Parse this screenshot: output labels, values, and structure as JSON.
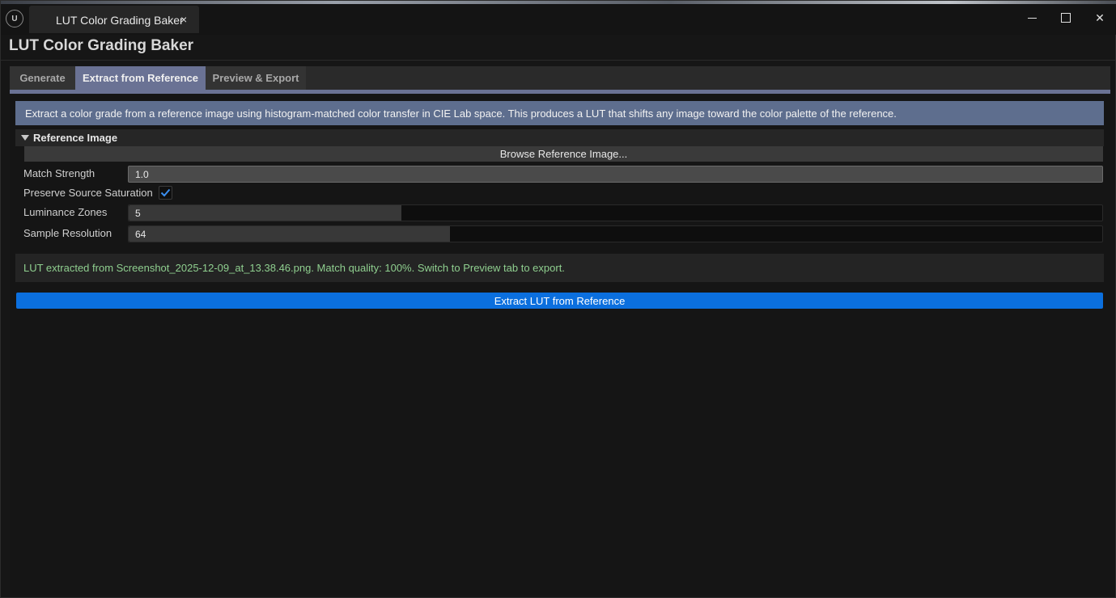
{
  "window": {
    "tab_title": "LUT Color Grading Baker",
    "tab_close": "×",
    "controls": {
      "minimize": "minimize-icon",
      "maximize": "maximize-icon",
      "close": "✕"
    }
  },
  "app": {
    "title": "LUT Color Grading Baker"
  },
  "tabs": [
    {
      "label": "Generate",
      "active": false
    },
    {
      "label": "Extract from Reference",
      "active": true
    },
    {
      "label": "Preview & Export",
      "active": false
    }
  ],
  "info": {
    "text": "Extract a color grade from a reference image using histogram-matched color transfer in CIE Lab space. This produces a LUT that shifts any image toward the color palette of the reference."
  },
  "reference_section": {
    "title": "Reference Image",
    "expanded": true,
    "browse_label": "Browse Reference Image..."
  },
  "settings": {
    "match_strength": {
      "label": "Match Strength",
      "value": "1.0",
      "fill": 1.0
    },
    "preserve_saturation": {
      "label": "Preserve Source Saturation",
      "checked": true
    },
    "luminance_zones": {
      "label": "Luminance Zones",
      "value": "5",
      "fill": 0.28
    },
    "sample_resolution": {
      "label": "Sample Resolution",
      "value": "64",
      "fill": 0.33
    }
  },
  "status": {
    "text": "LUT extracted from Screenshot_2025-12-09_at_13.38.46.png. Match quality: 100%. Switch to Preview tab to export."
  },
  "actions": {
    "extract_label": "Extract LUT from Reference"
  },
  "colors": {
    "accent_tab": "#6a7294",
    "info_bg": "#5e6e8e",
    "primary_button": "#0b6fde",
    "status_text": "#8fcf8f"
  }
}
